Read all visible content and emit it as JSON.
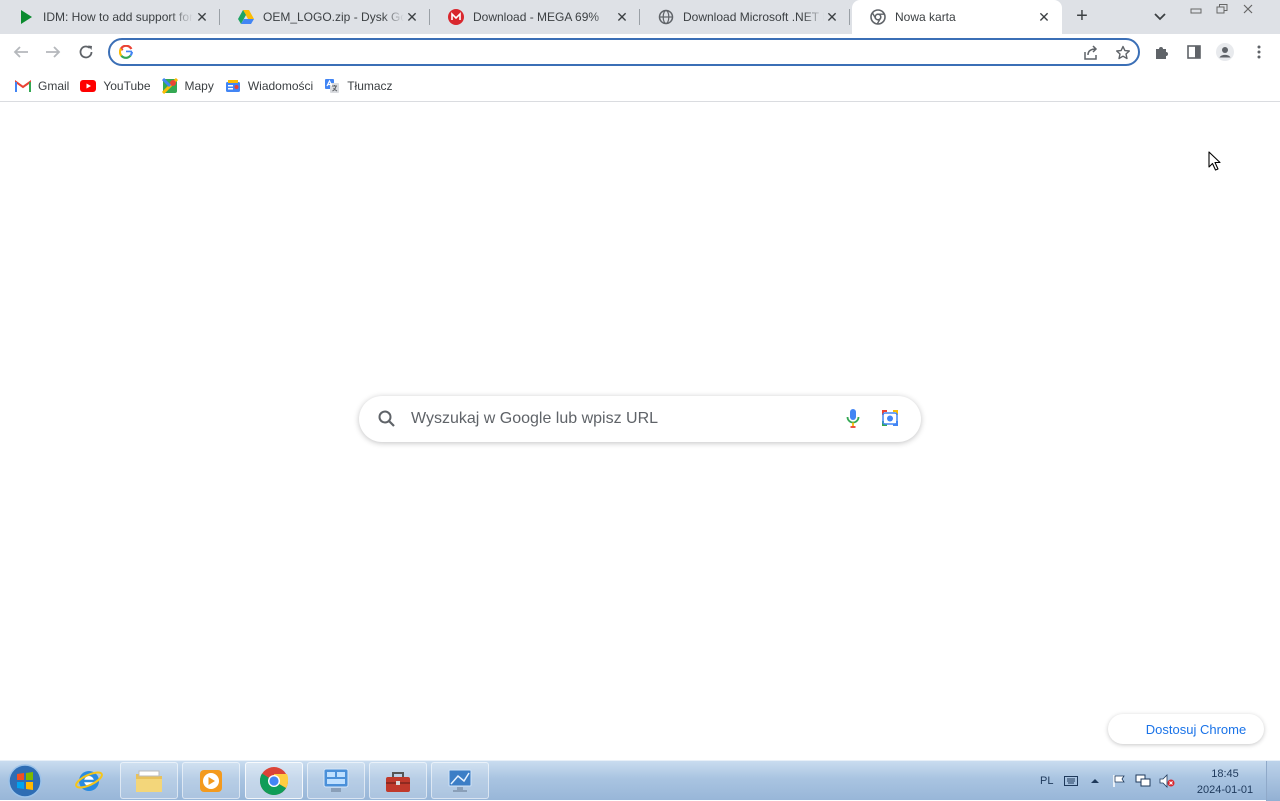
{
  "browser": {
    "tabs": [
      {
        "title": "IDM: How to add support for",
        "icon": "idm-play-icon"
      },
      {
        "title": "OEM_LOGO.zip - Dysk Google",
        "icon": "google-drive-icon"
      },
      {
        "title": "Download - MEGA 69%",
        "icon": "mega-icon"
      },
      {
        "title": "Download Microsoft .NET Framework",
        "icon": "globe-icon"
      },
      {
        "title": "Nowa karta",
        "icon": "chrome-icon",
        "active": true
      }
    ],
    "omnibox": {
      "value": "",
      "placeholder": ""
    },
    "bookmarks": [
      {
        "label": "Gmail",
        "icon": "gmail-icon"
      },
      {
        "label": "YouTube",
        "icon": "youtube-icon"
      },
      {
        "label": "Mapy",
        "icon": "maps-icon"
      },
      {
        "label": "Wiadomości",
        "icon": "news-icon"
      },
      {
        "label": "Tłumacz",
        "icon": "translate-icon"
      }
    ]
  },
  "newtab": {
    "search_placeholder": "Wyszukaj w Google lub wpisz URL",
    "customize_label": "Dostosuj Chrome"
  },
  "taskbar": {
    "apps": [
      "internet-explorer",
      "file-explorer",
      "media-player",
      "chrome",
      "control-panel",
      "toolbox",
      "display-settings"
    ],
    "language": "PL",
    "time": "18:45",
    "date": "2024-01-01"
  },
  "colors": {
    "accent": "#1a73e8",
    "tabstrip": "#dee1e6",
    "omnibox_focus": "#3b6fb6"
  }
}
